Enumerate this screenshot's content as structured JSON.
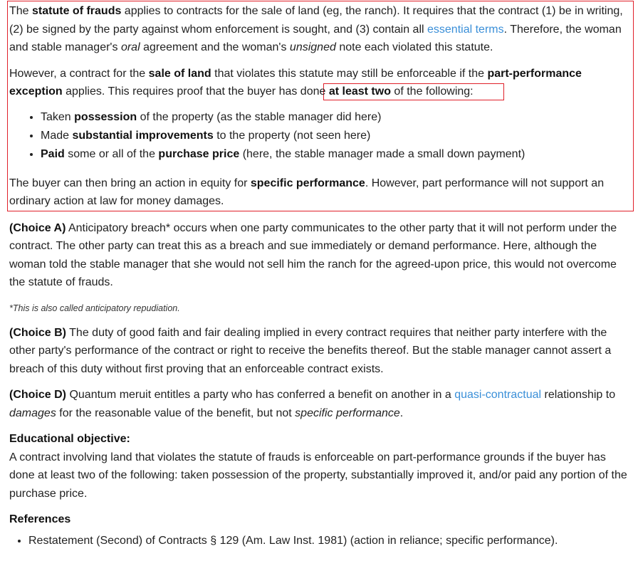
{
  "highlight_box_color": "#e0202a",
  "link_color": "#3a8fd8",
  "p1": {
    "t1": "The ",
    "b1": "statute of frauds",
    "t2": " applies to contracts for the sale of land (eg, the ranch).  It requires that the contract (1) be in writing, (2) be signed by the party against whom enforcement is sought, and (3) contain all ",
    "link": "essential terms",
    "t3": ".  Therefore, the woman and stable manager's ",
    "i1": "oral",
    "t4": " agreement and the woman's ",
    "i2": "unsigned",
    "t5": " note each violated this statute."
  },
  "p2": {
    "t1": "However, a contract for the ",
    "b1": "sale of land",
    "t2": " that violates this statute may still be enforceable if the ",
    "b2": "part-performance exception",
    "t3": " applies.  This requires proof that the buyer has done ",
    "b3": "at least two",
    "t4": " of the following:"
  },
  "bullets": [
    {
      "t1": "Taken ",
      "b1": "possession",
      "t2": " of the property (as the stable manager did here)",
      "b2": "",
      "t3": ""
    },
    {
      "t1": "Made ",
      "b1": "substantial improvements",
      "t2": " to the property (not seen here)",
      "b2": "",
      "t3": ""
    },
    {
      "t1": "",
      "b1": "Paid",
      "t2": " some or all of the ",
      "b2": "purchase price",
      "t3": " (here, the stable manager made a small down payment)"
    }
  ],
  "p3": {
    "t1": "The buyer can then bring an action in equity for ",
    "b1": "specific performance",
    "t2": ".  However, part performance will not support an ordinary action at law for money damages."
  },
  "choiceA": {
    "label": "(Choice A)",
    "text": "  Anticipatory breach* occurs when one party communicates to the other party that it will not perform under the contract.  The other party can treat this as a breach and sue immediately or demand performance.  Here, although the woman told the stable manager that she would not sell him the ranch for the agreed-upon price, this would not overcome the statute of frauds."
  },
  "footnote": "*This is also called anticipatory repudiation.",
  "choiceB": {
    "label": "(Choice B)",
    "text": "  The duty of good faith and fair dealing implied in every contract requires that neither party interfere with the other party's performance of the contract or right to receive the benefits thereof.  But the stable manager cannot assert a breach of this duty without first proving that an enforceable contract exists."
  },
  "choiceD": {
    "label": "(Choice D)",
    "t1": "  Quantum meruit entitles a party who has conferred a benefit on another in a ",
    "link": "quasi-contractual",
    "t2": " relationship to ",
    "i1": "damages",
    "t3": " for the reasonable value of the benefit, but not ",
    "i2": "specific performance",
    "t4": "."
  },
  "objective": {
    "heading": "Educational objective:",
    "text": "A contract involving land that violates the statute of frauds is enforceable on part-performance grounds if the buyer has done at least two of the following: taken possession of the property, substantially improved it, and/or paid any portion of the purchase price."
  },
  "references": {
    "heading": "References",
    "items": [
      "Restatement (Second) of Contracts § 129 (Am. Law Inst. 1981) (action in reliance; specific performance)."
    ]
  }
}
